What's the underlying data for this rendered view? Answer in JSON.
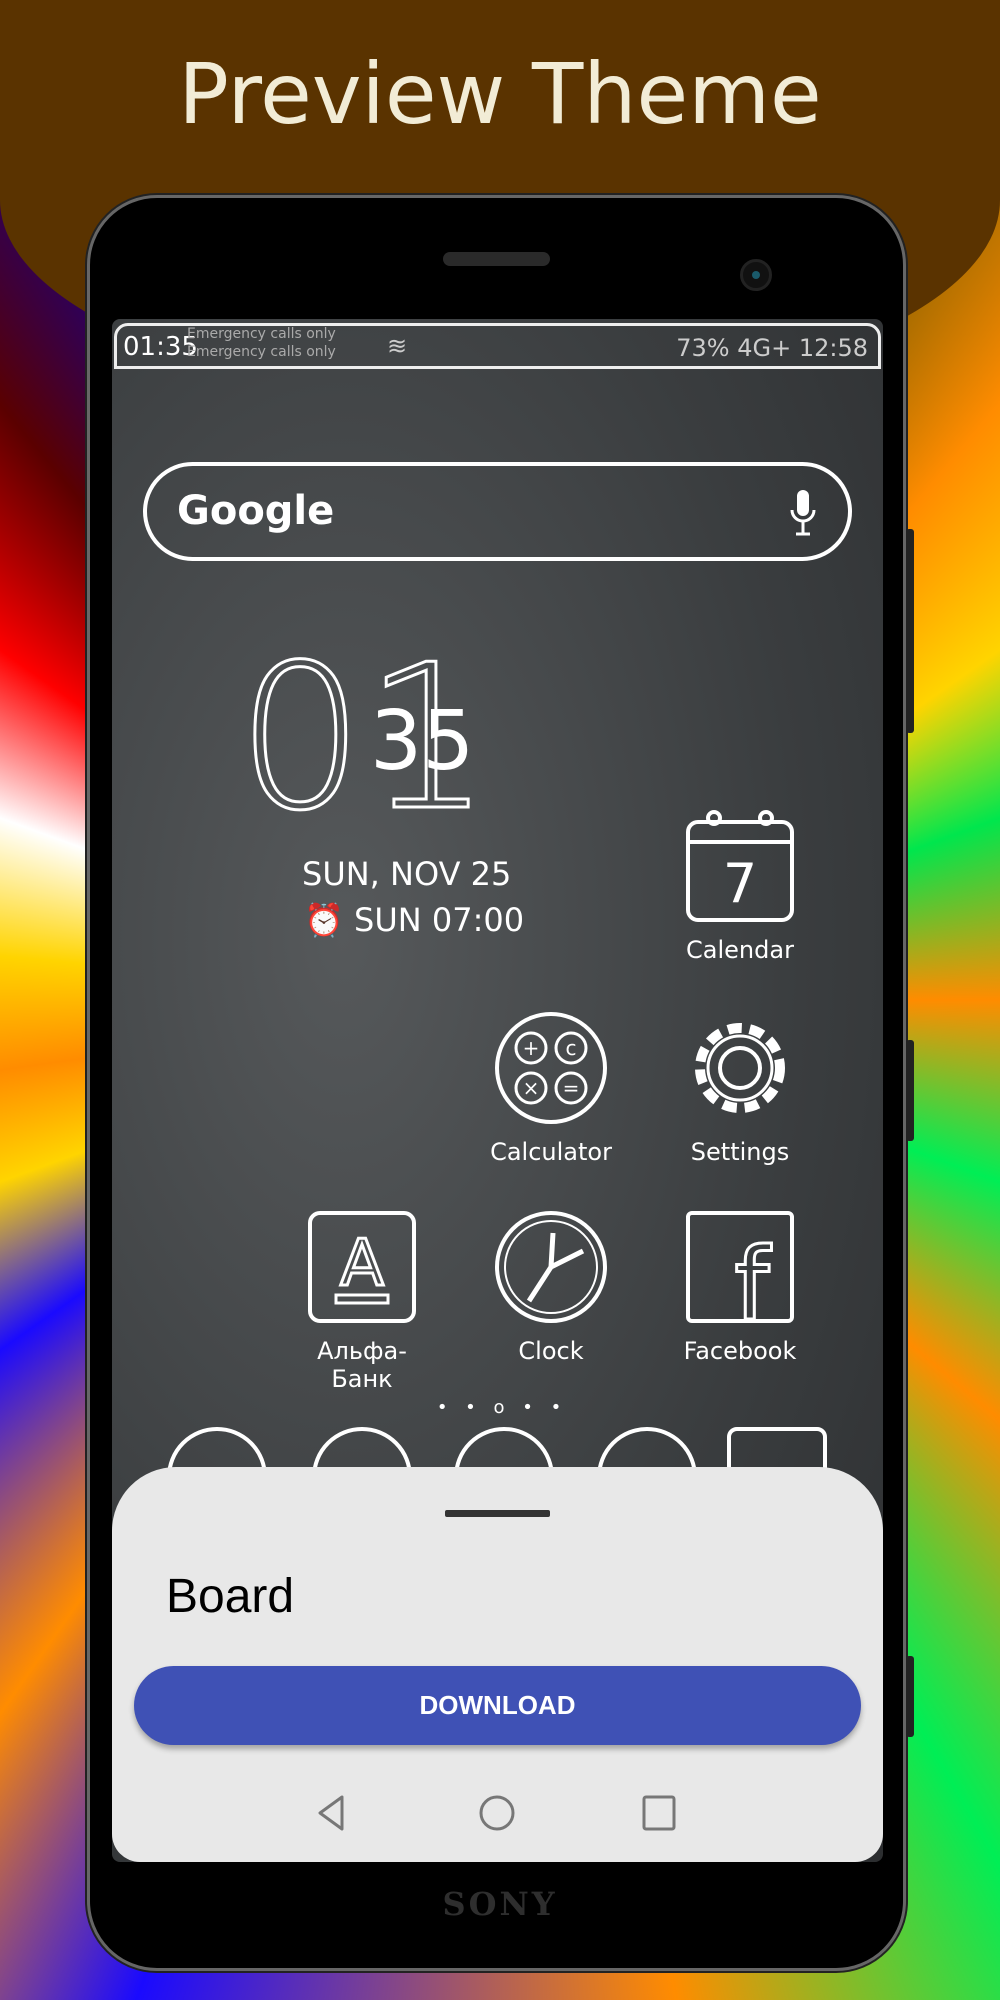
{
  "header": {
    "title": "Preview Theme"
  },
  "status_bar": {
    "time": "01:35",
    "carrier_line1": "Emergency calls only",
    "carrier_line2": "Emergency calls only",
    "right": "73% 4G+ 12:58"
  },
  "search": {
    "logo": "Google",
    "mic_icon": "mic-icon"
  },
  "clock": {
    "hour": "01",
    "minute": "35",
    "date": "SUN, NOV 25",
    "alarm": "SUN 07:00"
  },
  "apps": [
    {
      "label": "Calendar",
      "icon": "calendar-icon",
      "day": "7"
    },
    {
      "label": "Calculator",
      "icon": "calculator-icon"
    },
    {
      "label": "Settings",
      "icon": "gear-icon"
    },
    {
      "label": "Альфа-Банк",
      "icon": "alfa-bank-icon",
      "glyph": "A"
    },
    {
      "label": "Clock",
      "icon": "clock-icon"
    },
    {
      "label": "Facebook",
      "icon": "facebook-icon",
      "glyph": "f"
    }
  ],
  "page_dots": "• • o • •",
  "sheet": {
    "theme_name": "Board",
    "download_label": "DOWNLOAD",
    "accent": "#3f51b5"
  },
  "device": {
    "brand": "SONY"
  }
}
